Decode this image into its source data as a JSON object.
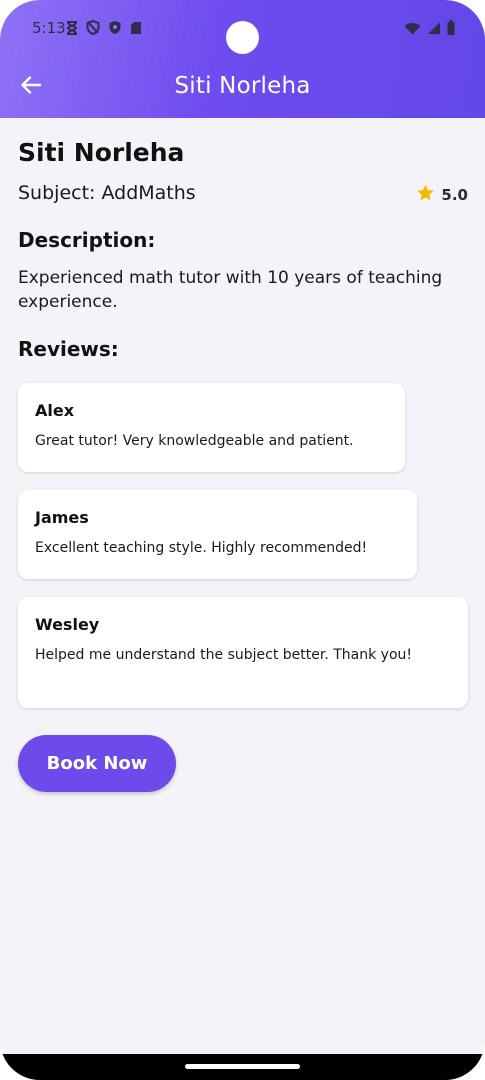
{
  "status_bar": {
    "time": "5:13",
    "left_icons": [
      "hourglass-icon",
      "shield-icon",
      "security-shield-icon",
      "sd-card-icon"
    ],
    "right_icons": [
      "wifi-icon",
      "cellular-signal-icon",
      "battery-icon"
    ]
  },
  "app_bar": {
    "title": "Siti Norleha",
    "back_icon": "arrow-left-icon"
  },
  "tutor": {
    "name": "Siti Norleha",
    "subject": "Subject: AddMaths",
    "rating": "5.0",
    "star_color": "#f5b800"
  },
  "description": {
    "heading": "Description:",
    "text": "Experienced math tutor with 10 years of teaching experience."
  },
  "reviews": {
    "heading": "Reviews:",
    "items": [
      {
        "author": "Alex",
        "text": "Great tutor! Very knowledgeable and patient."
      },
      {
        "author": "James",
        "text": "Excellent teaching style. Highly recommended!"
      },
      {
        "author": "Wesley",
        "text": "Helped me understand the subject better. Thank you!"
      }
    ]
  },
  "book_button": {
    "label": "Book Now",
    "color": "#6c4bea"
  },
  "colors": {
    "header_gradient_start": "#8f72f6",
    "header_gradient_end": "#6447e8",
    "background": "#f4f4f8"
  }
}
